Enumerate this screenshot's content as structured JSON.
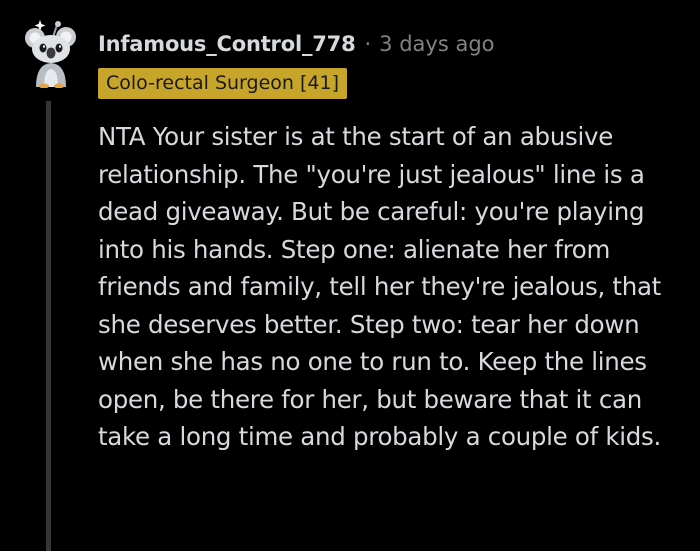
{
  "comment": {
    "username": "Infamous_Control_778",
    "separator": "·",
    "timestamp": "3 days ago",
    "flair": "Colo-rectal Surgeon [41]",
    "body": "NTA Your sister is at the start of an abusive relationship. The \"you're just jealous\" line is a dead giveaway. But be careful: you're playing into his hands. Step one: alienate her from friends and family, tell her they're jealous, that she deserves better. Step two: tear her down when she has no one to run to. Keep the lines open, be there for her, but beware that it can take a long time and probably a couple of kids."
  },
  "avatar": {
    "icon": "snoo-koala-avatar-icon"
  },
  "colors": {
    "background": "#000000",
    "text": "#d7dadc",
    "meta": "#818384",
    "flair_background": "#c7a52a",
    "flair_text": "#1a1a1b",
    "thread_line": "#343536"
  }
}
